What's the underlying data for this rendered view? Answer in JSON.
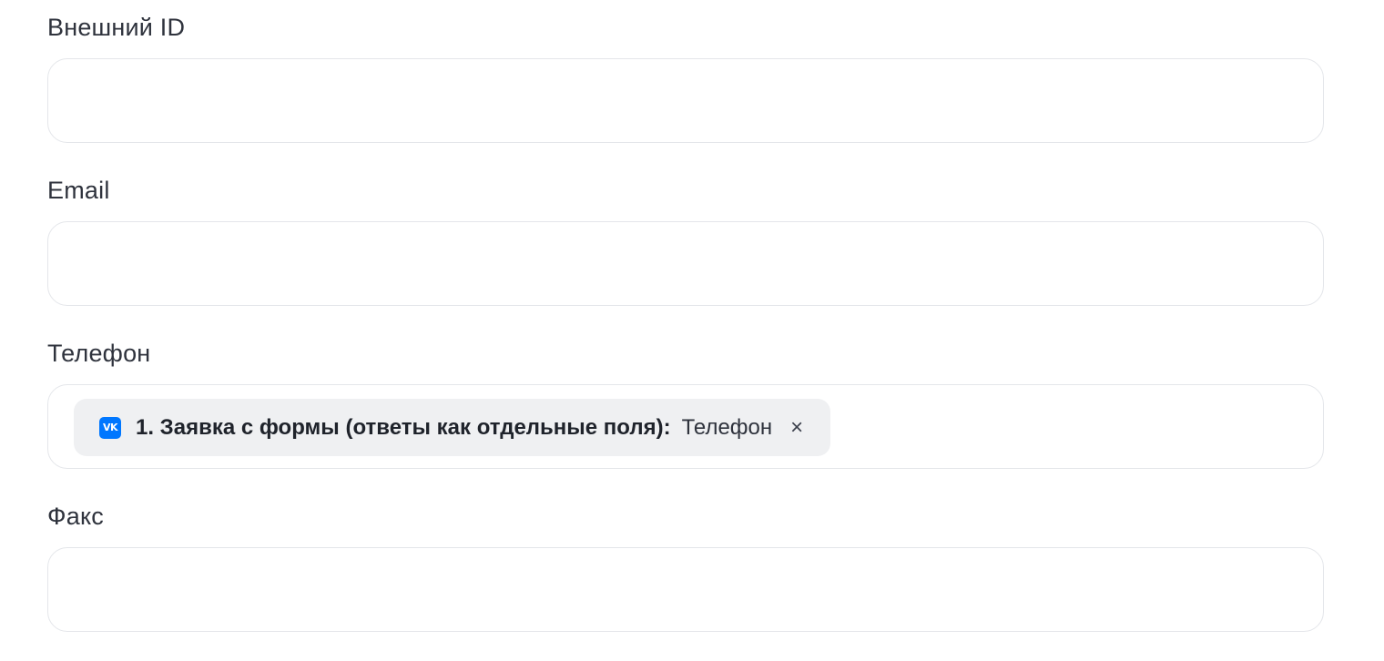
{
  "form": {
    "fields": [
      {
        "label": "Внешний ID",
        "value": ""
      },
      {
        "label": "Email",
        "value": ""
      },
      {
        "label": "Телефон",
        "value": "",
        "chip": {
          "icon": "vk-icon",
          "icon_text": "VK",
          "source": "1. Заявка с формы (ответы как отдельные поля):",
          "field": "Телефон",
          "remove": "×",
          "accent": "#0077ff"
        }
      },
      {
        "label": "Факс",
        "value": ""
      }
    ]
  }
}
